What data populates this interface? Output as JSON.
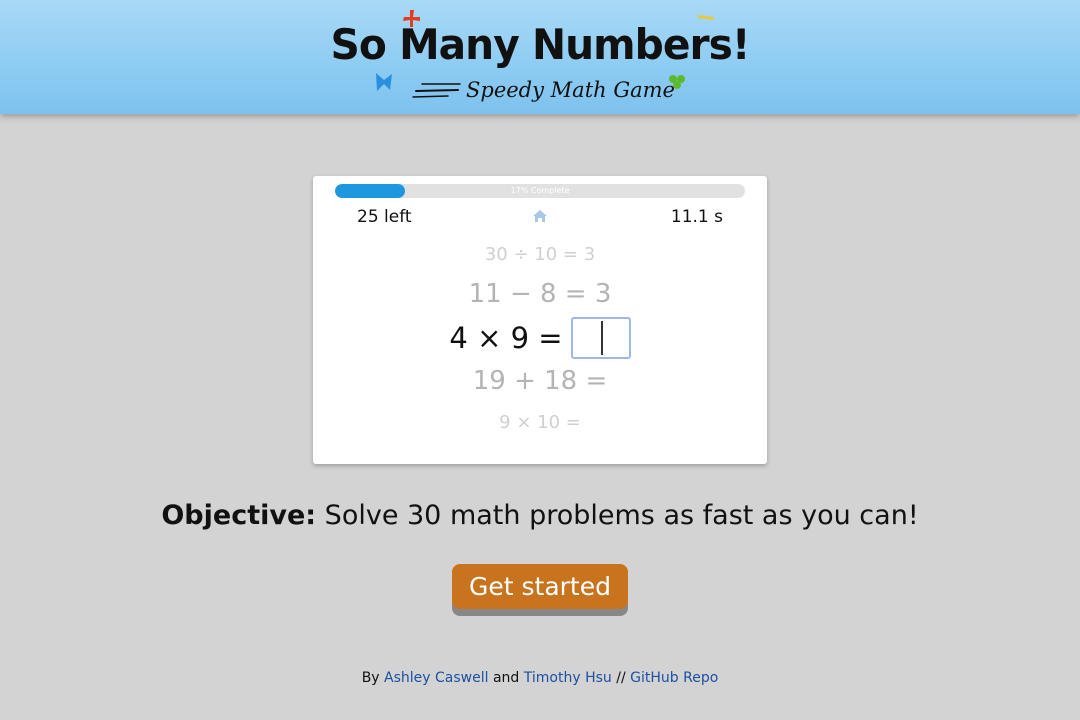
{
  "header": {
    "title": "So Many Numbers!",
    "subtitle": "Speedy Math Game"
  },
  "game": {
    "progress_percent": 17,
    "progress_text": "17% Complete",
    "left_text": "25 left",
    "timer_text": "11.1 s",
    "home_icon": "home-icon",
    "problems": {
      "prev2": "30 ÷ 10 = 3",
      "prev1": "11 − 8 = 3",
      "current": "4 × 9 =",
      "next1": "19 + 18 =",
      "next2": "9 × 10 ="
    },
    "answer_value": ""
  },
  "objective": {
    "label": "Objective:",
    "text": " Solve 30 math problems as fast as you can!"
  },
  "cta": {
    "label": "Get started"
  },
  "footer": {
    "by": "By ",
    "author1": "Ashley Caswell",
    "and": " and ",
    "author2": "Timothy Hsu",
    "sep": " // ",
    "repo": "GitHub Repo"
  },
  "colors": {
    "header_blue": "#8fcdf3",
    "progress_blue": "#1d98df",
    "button_orange": "#c8741f",
    "link_blue": "#1d4fa3",
    "background": "#d3d3d3"
  }
}
